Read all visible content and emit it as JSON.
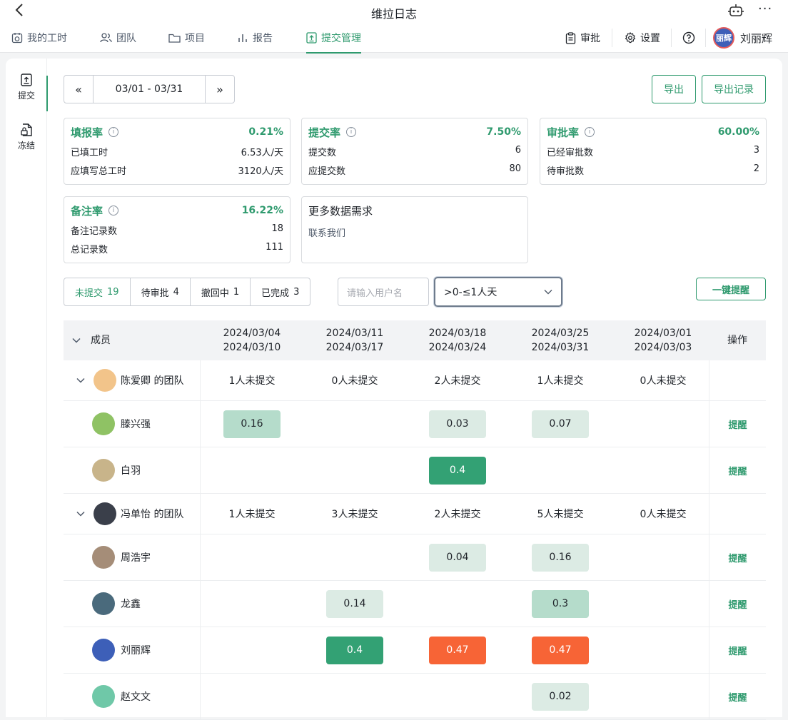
{
  "app": {
    "title": "维拉日志"
  },
  "nav": {
    "tabs": [
      {
        "label": "我的工时"
      },
      {
        "label": "团队"
      },
      {
        "label": "项目"
      },
      {
        "label": "报告"
      },
      {
        "label": "提交管理"
      }
    ],
    "approve": "审批",
    "settings": "设置",
    "user_name": "刘丽辉",
    "avatar_text": "丽辉"
  },
  "sidebar": {
    "items": [
      {
        "label": "提交"
      },
      {
        "label": "冻结"
      }
    ]
  },
  "toolbar": {
    "date_range": "03/01 - 03/31",
    "export": "导出",
    "export_log": "导出记录"
  },
  "stats": [
    {
      "name": "填报率",
      "pct": "0.21%",
      "rows": [
        {
          "k": "已填工时",
          "v": "6.53人/天"
        },
        {
          "k": "应填写总工时",
          "v": "3120人/天"
        }
      ]
    },
    {
      "name": "提交率",
      "pct": "7.50%",
      "rows": [
        {
          "k": "提交数",
          "v": "6"
        },
        {
          "k": "应提交数",
          "v": "80"
        }
      ]
    },
    {
      "name": "审批率",
      "pct": "60.00%",
      "rows": [
        {
          "k": "已经审批数",
          "v": "3"
        },
        {
          "k": "待审批数",
          "v": "2"
        }
      ]
    },
    {
      "name": "备注率",
      "pct": "16.22%",
      "rows": [
        {
          "k": "备注记录数",
          "v": "18"
        },
        {
          "k": "总记录数",
          "v": "111"
        }
      ]
    }
  ],
  "more_card": {
    "title": "更多数据需求",
    "sub": "联系我们"
  },
  "filters": {
    "segments": [
      {
        "label": "未提交",
        "count": "19"
      },
      {
        "label": "待审批",
        "count": "4"
      },
      {
        "label": "撤回中",
        "count": "1"
      },
      {
        "label": "已完成",
        "count": "3"
      }
    ],
    "search_placeholder": "请输入用户名",
    "select_value": ">0-≤1人天",
    "remind_all": "一键提醒"
  },
  "table": {
    "member_header": "成员",
    "op_header": "操作",
    "weeks": [
      {
        "a": "2024/03/04",
        "b": "2024/03/10"
      },
      {
        "a": "2024/03/11",
        "b": "2024/03/17"
      },
      {
        "a": "2024/03/18",
        "b": "2024/03/24"
      },
      {
        "a": "2024/03/25",
        "b": "2024/03/31"
      },
      {
        "a": "2024/03/01",
        "b": "2024/03/03"
      }
    ],
    "remind": "提醒",
    "groups": [
      {
        "team": "陈爱卿 的团队",
        "counts": [
          "1人未提交",
          "0人未提交",
          "2人未提交",
          "1人未提交",
          "0人未提交"
        ],
        "members": [
          {
            "name": "滕兴强",
            "cells": [
              {
                "v": "0.16",
                "c": "md"
              },
              null,
              {
                "v": "0.03",
                "c": "lg"
              },
              {
                "v": "0.07",
                "c": "lg"
              },
              null
            ]
          },
          {
            "name": "白羽",
            "cells": [
              null,
              null,
              {
                "v": "0.4",
                "c": "dk"
              },
              null,
              null
            ]
          }
        ]
      },
      {
        "team": "冯单怡 的团队",
        "counts": [
          "1人未提交",
          "3人未提交",
          "2人未提交",
          "5人未提交",
          "0人未提交"
        ],
        "members": [
          {
            "name": "周浩宇",
            "cells": [
              null,
              null,
              {
                "v": "0.04",
                "c": "lg"
              },
              {
                "v": "0.16",
                "c": "lg"
              },
              null
            ]
          },
          {
            "name": "龙鑫",
            "cells": [
              null,
              {
                "v": "0.14",
                "c": "lg"
              },
              null,
              {
                "v": "0.3",
                "c": "md"
              },
              null
            ]
          },
          {
            "name": "刘丽辉",
            "cells": [
              null,
              {
                "v": "0.4",
                "c": "dk"
              },
              {
                "v": "0.47",
                "c": "or"
              },
              {
                "v": "0.47",
                "c": "or"
              },
              null
            ]
          },
          {
            "name": "赵文文",
            "cells": [
              null,
              null,
              null,
              {
                "v": "0.02",
                "c": "lg"
              },
              null
            ]
          }
        ]
      }
    ]
  }
}
